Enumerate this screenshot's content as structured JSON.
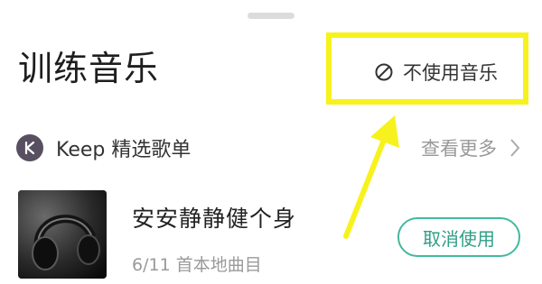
{
  "sheet": {
    "title": "训练音乐"
  },
  "no_music": {
    "label": "不使用音乐",
    "icon": "no-entry-icon"
  },
  "playlist": {
    "logo_icon": "keep-logo-icon",
    "title": "Keep 精选歌单",
    "view_more": "查看更多",
    "chevron_icon": "chevron-right-icon"
  },
  "track": {
    "name": "安安静静健个身",
    "subtitle": "6/11 首本地曲目",
    "cancel_label": "取消使用",
    "cover_icon": "headphones-cover"
  },
  "colors": {
    "highlight": "#f7f21d",
    "accent_green": "#43b99d",
    "keep_logo": "#584f60",
    "muted_text": "#999999"
  }
}
